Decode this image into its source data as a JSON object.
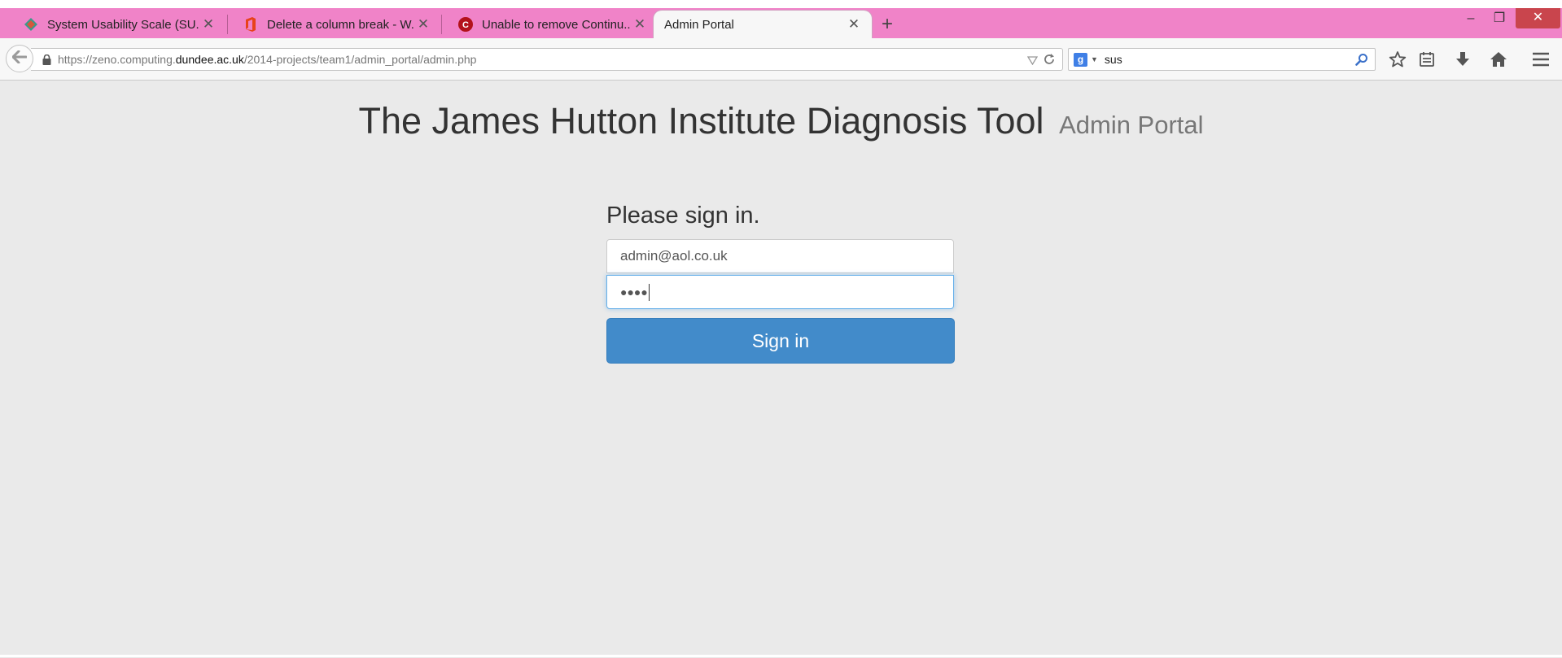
{
  "browser": {
    "tabs": [
      {
        "title": "System Usability Scale (SU...",
        "icon": "usability-site-icon",
        "active": false
      },
      {
        "title": "Delete a column break - W...",
        "icon": "office-icon",
        "active": false
      },
      {
        "title": "Unable to remove Continu...",
        "icon": "site-c-icon",
        "active": false
      },
      {
        "title": "Admin Portal",
        "icon": "",
        "active": true
      }
    ],
    "new_tab_label": "+",
    "window_controls": {
      "minimize": "–",
      "maximize": "❐",
      "close": "✕"
    },
    "address": {
      "prefix": "https://zeno.computing.",
      "host": "dundee.ac.uk",
      "path": "/2014-projects/team1/admin_portal/admin.php"
    },
    "search": {
      "engine_letter": "g",
      "value": "sus"
    }
  },
  "page": {
    "title": "The James Hutton Institute Diagnosis Tool",
    "subtitle": "Admin Portal",
    "signin_heading": "Please sign in.",
    "email_value": "admin@aol.co.uk",
    "password_mask": "●●●●",
    "signin_button": "Sign in"
  },
  "colors": {
    "tabstrip": "#f083c8",
    "page_background": "#eaeaea",
    "primary_button": "#428bca",
    "focus_border": "#66afe9"
  }
}
